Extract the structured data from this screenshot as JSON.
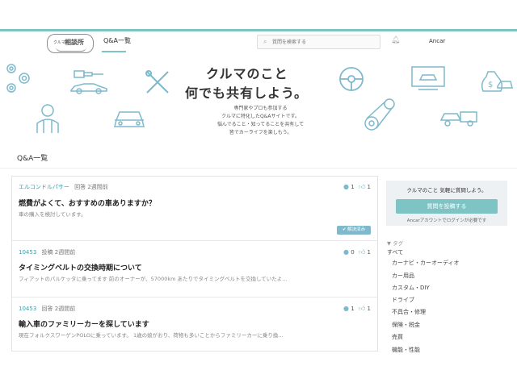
{
  "header": {
    "logo_small": "クルマの",
    "logo_big": "相談所",
    "nav_label": "Q&A一覧",
    "search_placeholder": "質問を検索する",
    "search_icon": "search-icon",
    "bell_icon": "bell-icon",
    "user_name": "Ancar"
  },
  "hero": {
    "title_line1": "クルマのこと",
    "title_line2": "何でも共有しよう。",
    "desc_lines": [
      "専門家やプロも参加する",
      "クルマに特化したQ&Aサイトです。",
      "悩んでること・知ってることを共有して",
      "皆でカーライフを楽しもう。"
    ]
  },
  "section_title": "Q&A一覧",
  "questions": [
    {
      "user": "エルコンドルパサー",
      "meta": "回答 2週間前",
      "comments": "1",
      "likes": "1",
      "title": "燃費がよくて、おすすめの車ありますか？",
      "body": "車の購入を検討しています。",
      "badge": "解決済み"
    },
    {
      "user": "10453",
      "meta": "投稿 2週間前",
      "comments": "0",
      "likes": "1",
      "title": "タイミングベルトの交換時期について",
      "body": "フィアットのパルケッタに乗ってます 前のオーナーが、57000km あたりでタイミングベルトを交換していたよ..."
    },
    {
      "user": "10453",
      "meta": "回答 2週間前",
      "comments": "1",
      "likes": "1",
      "title": "輸入車のファミリーカーを探しています",
      "body": "現在フォルクスワーゲンPOLOに乗っています。 1歳の娘がおり、荷物も多いことからファミリーカーに乗り換..."
    }
  ],
  "sidebar": {
    "box_title": "クルマのこと 気軽に質問しよう。",
    "button_label": "質問を投稿する",
    "note": "Ancarアカウントでログインが必要です",
    "tag_header": "▼ タグ",
    "tags": [
      "すべて",
      "カーナビ・カーオーディオ",
      "カー用品",
      "カスタム・DIY",
      "ドライブ",
      "不具合・修理",
      "保険・税金",
      "売買",
      "機能・性能"
    ]
  },
  "colors": {
    "accent": "#7fc4c4",
    "icon_stroke": "#7fb9cc",
    "link": "#3a9dad"
  }
}
